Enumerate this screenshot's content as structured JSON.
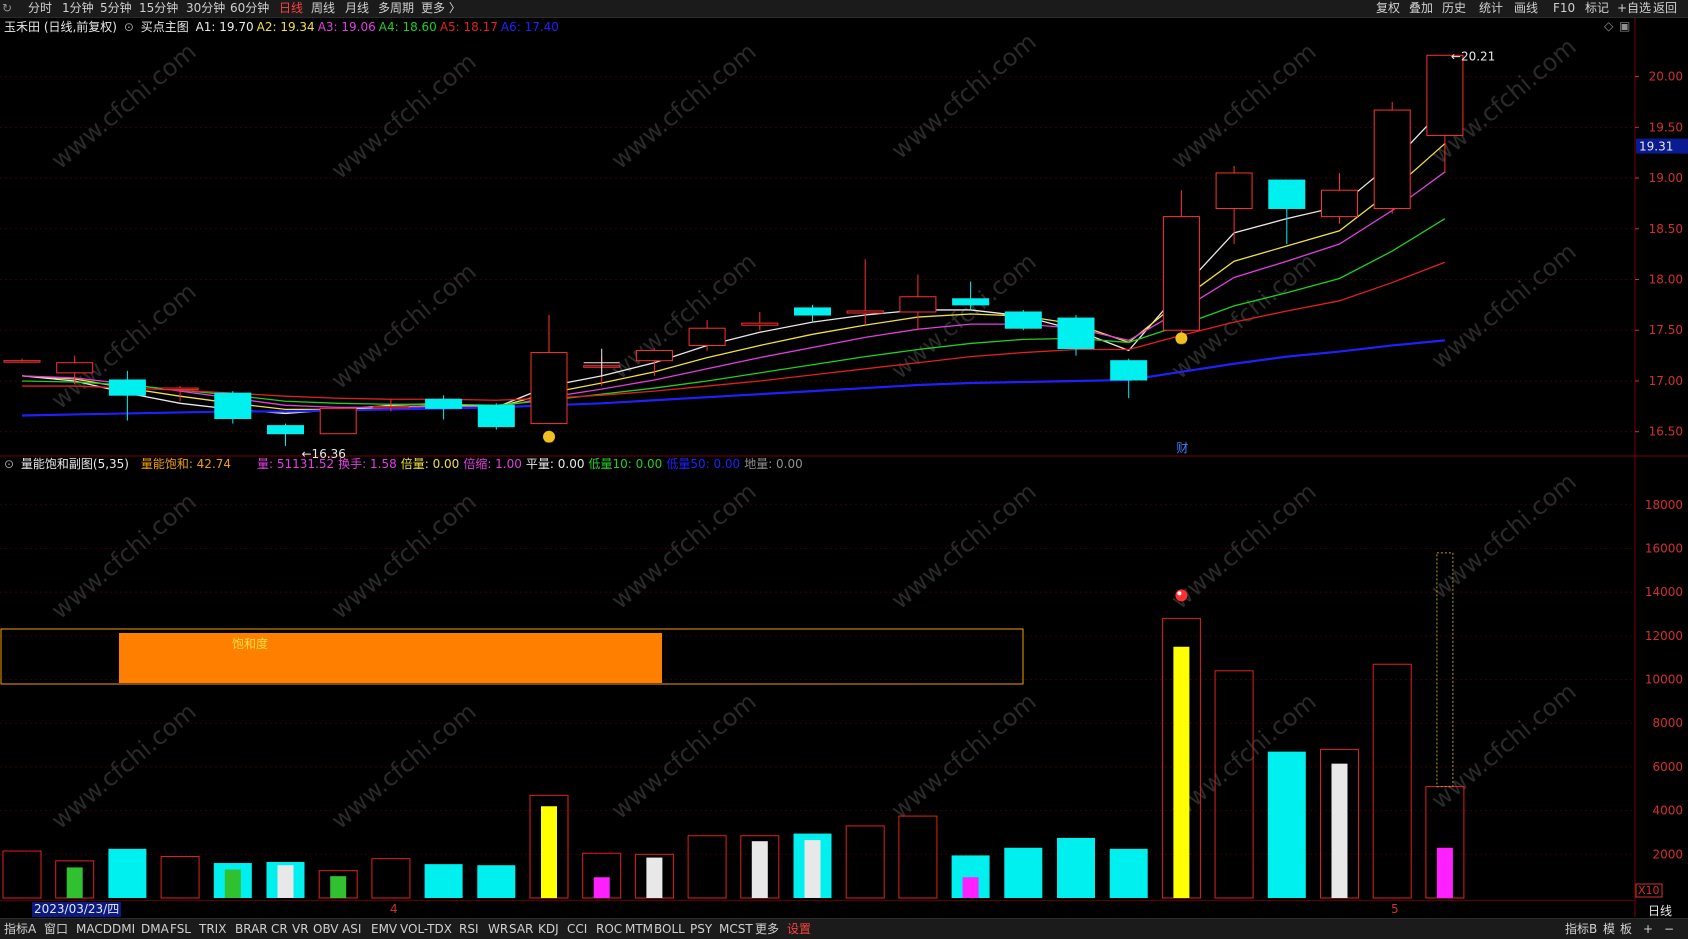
{
  "toolbar": {
    "tabs": [
      "分时",
      "1分钟",
      "5分钟",
      "15分钟",
      "30分钟",
      "60分钟",
      "日线",
      "周线",
      "月线",
      "多周期",
      "更多 〉"
    ],
    "active_tab": "日线",
    "right_buttons": [
      "复权",
      "叠加",
      "历史",
      "统计",
      "画线",
      "F10",
      "标记",
      "+自选",
      "返回"
    ]
  },
  "main_chart": {
    "stock_title": "玉禾田 (日线,前复权)",
    "indicator_name": "买点主图",
    "ma_values": [
      {
        "label": "A1:",
        "value": "19.70",
        "color": "#e8e8e8"
      },
      {
        "label": "A2:",
        "value": "19.34",
        "color": "#f0e040"
      },
      {
        "label": "A3:",
        "value": "19.06",
        "color": "#e040e0"
      },
      {
        "label": "A4:",
        "value": "18.60",
        "color": "#20d020"
      },
      {
        "label": "A5:",
        "value": "18.17",
        "color": "#e02020"
      },
      {
        "label": "A6:",
        "value": "17.40",
        "color": "#2020ff"
      }
    ],
    "price_ticks": [
      "20.00",
      "19.50",
      "19.00",
      "18.50",
      "18.00",
      "17.50",
      "17.00",
      "16.50"
    ],
    "current_price": "19.31",
    "high_label": "20.21",
    "low_label": "16.36",
    "cai_marker": "财",
    "watermark": "www.cfchi.com"
  },
  "sub_chart": {
    "indicator_title": "量能饱和副图(5,35)",
    "stats": [
      {
        "label": "量能饱和:",
        "value": "42.74",
        "color": "#f0a000"
      },
      {
        "label": "量:",
        "value": "51131.52",
        "color": "#e040e0"
      },
      {
        "label": "换手:",
        "value": "1.58",
        "color": "#e040e0"
      },
      {
        "label": "倍量:",
        "value": "0.00",
        "color": "#f0e040"
      },
      {
        "label": "倍缩:",
        "value": "1.00",
        "color": "#e040e0"
      },
      {
        "label": "平量:",
        "value": "0.00",
        "color": "#e8e8e8"
      },
      {
        "label": "低量10:",
        "value": "0.00",
        "color": "#20d020"
      },
      {
        "label": "低量50:",
        "value": "0.00",
        "color": "#2020ff"
      },
      {
        "label": "地量:",
        "value": "0.00",
        "color": "#909090"
      }
    ],
    "saturation_label": "饱和度",
    "saturation_value": 0.55,
    "volume_ticks": [
      "18000",
      "16000",
      "14000",
      "12000",
      "10000",
      "8000",
      "6000",
      "4000",
      "2000"
    ],
    "scale_label": "X10"
  },
  "date_axis": {
    "current_date": "2023/03/23/四",
    "month_4": "4",
    "month_5": "5",
    "period_label": "日线"
  },
  "bottom_tabs": [
    "指标A",
    "窗口",
    "MACD",
    "DMI",
    "DMA",
    "FSL",
    "TRIX",
    "BRAR",
    "CR",
    "VR",
    "OBV",
    "ASI",
    "EMV",
    "VOL-TDX",
    "RSI",
    "WR",
    "SAR",
    "KDJ",
    "CCI",
    "ROC",
    "MTM",
    "BOLL",
    "PSY",
    "MCST",
    "更多",
    "设置"
  ],
  "bottom_right": [
    "指标B",
    "模",
    "板",
    "+",
    "−"
  ],
  "chart_data": {
    "type": "candlestick",
    "candles": [
      {
        "o": 17.2,
        "c": 17.2,
        "h": 17.22,
        "l": 17.18
      },
      {
        "o": 17.08,
        "c": 17.18,
        "h": 17.25,
        "l": 16.97
      },
      {
        "o": 17.01,
        "c": 16.86,
        "h": 17.1,
        "l": 16.61
      },
      {
        "o": 16.93,
        "c": 16.93,
        "h": 16.95,
        "l": 16.8
      },
      {
        "o": 16.88,
        "c": 16.63,
        "h": 16.9,
        "l": 16.58
      },
      {
        "o": 16.56,
        "c": 16.48,
        "h": 16.58,
        "l": 16.36
      },
      {
        "o": 16.48,
        "c": 16.73,
        "h": 16.75,
        "l": 16.48
      },
      {
        "o": 16.75,
        "c": 16.75,
        "h": 16.82,
        "l": 16.7
      },
      {
        "o": 16.82,
        "c": 16.73,
        "h": 16.86,
        "l": 16.62
      },
      {
        "o": 16.76,
        "c": 16.55,
        "h": 16.78,
        "l": 16.52
      },
      {
        "o": 16.58,
        "c": 17.28,
        "h": 17.65,
        "l": 16.58
      },
      {
        "o": 17.15,
        "c": 17.15,
        "h": 17.25,
        "l": 16.95
      },
      {
        "o": 17.2,
        "c": 17.3,
        "h": 17.32,
        "l": 17.05
      },
      {
        "o": 17.35,
        "c": 17.52,
        "h": 17.6,
        "l": 17.3
      },
      {
        "o": 17.55,
        "c": 17.57,
        "h": 17.68,
        "l": 17.5
      },
      {
        "o": 17.72,
        "c": 17.65,
        "h": 17.75,
        "l": 17.58
      },
      {
        "o": 17.67,
        "c": 17.69,
        "h": 18.2,
        "l": 17.55
      },
      {
        "o": 17.68,
        "c": 17.83,
        "h": 18.05,
        "l": 17.5
      },
      {
        "o": 17.81,
        "c": 17.75,
        "h": 17.98,
        "l": 17.7
      },
      {
        "o": 17.68,
        "c": 17.52,
        "h": 17.7,
        "l": 17.5
      },
      {
        "o": 17.62,
        "c": 17.32,
        "h": 17.65,
        "l": 17.25
      },
      {
        "o": 17.2,
        "c": 17.01,
        "h": 17.22,
        "l": 16.83
      },
      {
        "o": 17.5,
        "c": 18.62,
        "h": 18.88,
        "l": 17.45
      },
      {
        "o": 18.7,
        "c": 19.05,
        "h": 19.12,
        "l": 18.35
      },
      {
        "o": 18.98,
        "c": 18.7,
        "h": 18.98,
        "l": 18.35
      },
      {
        "o": 18.62,
        "c": 18.88,
        "h": 19.05,
        "l": 18.55
      },
      {
        "o": 18.7,
        "c": 19.67,
        "h": 19.75,
        "l": 18.65
      },
      {
        "o": 19.42,
        "c": 20.21,
        "h": 20.21,
        "l": 19.05
      }
    ],
    "ma_lines": {
      "A1": [
        17.05,
        17.0,
        16.88,
        16.78,
        16.72,
        16.68,
        16.72,
        16.76,
        16.78,
        16.74,
        16.95,
        17.05,
        17.18,
        17.35,
        17.48,
        17.58,
        17.65,
        17.7,
        17.7,
        17.64,
        17.5,
        17.3,
        17.9,
        18.46,
        18.6,
        18.72,
        19.15,
        19.7
      ],
      "A2": [
        17.05,
        17.02,
        16.93,
        16.85,
        16.78,
        16.72,
        16.72,
        16.74,
        16.76,
        16.74,
        16.88,
        16.98,
        17.09,
        17.23,
        17.35,
        17.46,
        17.55,
        17.63,
        17.66,
        17.64,
        17.56,
        17.38,
        17.8,
        18.18,
        18.33,
        18.48,
        18.88,
        19.34
      ],
      "A3": [
        17.05,
        17.03,
        16.97,
        16.9,
        16.83,
        16.76,
        16.74,
        16.74,
        16.75,
        16.74,
        16.84,
        16.92,
        17.01,
        17.12,
        17.23,
        17.33,
        17.43,
        17.51,
        17.56,
        17.56,
        17.52,
        17.4,
        17.7,
        18.02,
        18.18,
        18.35,
        18.68,
        19.06
      ],
      "A4": [
        17.0,
        16.99,
        16.96,
        16.91,
        16.86,
        16.8,
        16.78,
        16.77,
        16.77,
        16.76,
        16.81,
        16.87,
        16.93,
        17.0,
        17.08,
        17.16,
        17.24,
        17.31,
        17.37,
        17.41,
        17.42,
        17.38,
        17.55,
        17.74,
        17.87,
        18.01,
        18.28,
        18.6
      ],
      "A5": [
        16.95,
        16.95,
        16.93,
        16.91,
        16.88,
        16.85,
        16.83,
        16.82,
        16.82,
        16.81,
        16.83,
        16.86,
        16.9,
        16.95,
        17.0,
        17.06,
        17.12,
        17.18,
        17.24,
        17.28,
        17.31,
        17.31,
        17.45,
        17.58,
        17.69,
        17.79,
        17.97,
        18.17
      ],
      "A6": [
        16.66,
        16.67,
        16.68,
        16.69,
        16.7,
        16.7,
        16.71,
        16.72,
        16.73,
        16.74,
        16.76,
        16.78,
        16.81,
        16.84,
        16.87,
        16.9,
        16.93,
        16.96,
        16.98,
        16.99,
        17.0,
        17.01,
        17.09,
        17.17,
        17.24,
        17.29,
        17.35,
        17.4
      ]
    },
    "volume": [
      2150,
      1700,
      2250,
      1900,
      1600,
      1650,
      1250,
      1800,
      1550,
      1500,
      4700,
      2050,
      2000,
      2850,
      2850,
      2950,
      3300,
      3750,
      1950,
      2300,
      2750,
      2250,
      12800,
      10400,
      6700,
      6800,
      10700,
      5100
    ],
    "volume_inner": [
      0,
      1400,
      0,
      0,
      1300,
      1500,
      1000,
      0,
      0,
      0,
      4200,
      950,
      1850,
      0,
      2600,
      2650,
      0,
      0,
      950,
      0,
      0,
      0,
      11500,
      0,
      0,
      6150,
      0,
      2300
    ],
    "ylim": [
      16.3,
      20.4
    ],
    "vol_ylim": [
      0,
      19500
    ]
  }
}
